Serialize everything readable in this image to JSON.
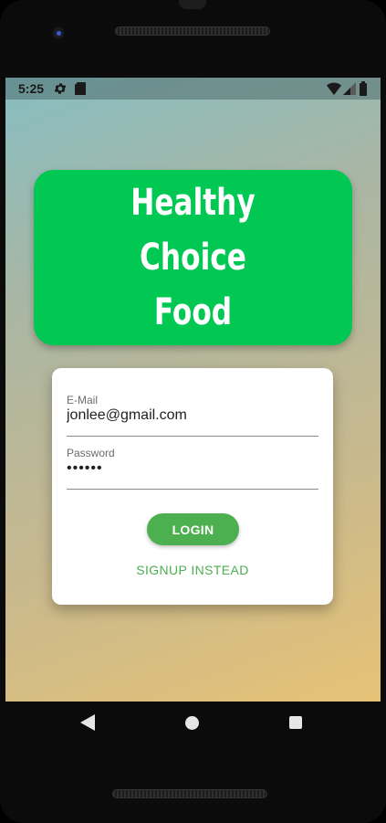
{
  "status_bar": {
    "time": "5:25",
    "icons": [
      "gear-icon",
      "sd-card-icon",
      "wifi-icon",
      "signal-icon",
      "battery-icon"
    ]
  },
  "app": {
    "title_lines": [
      "Healthy",
      "Choice",
      "Food"
    ],
    "brand_color": "#00c853",
    "accent_color": "#4caf50"
  },
  "auth": {
    "email_label": "E-Mail",
    "email_value": "jonlee@gmail.com",
    "password_label": "Password",
    "password_value": "••••••",
    "login_label": "LOGIN",
    "signup_label": "SIGNUP INSTEAD"
  },
  "nav_bar": {
    "icons": [
      "back-icon",
      "home-icon",
      "recents-icon"
    ]
  }
}
